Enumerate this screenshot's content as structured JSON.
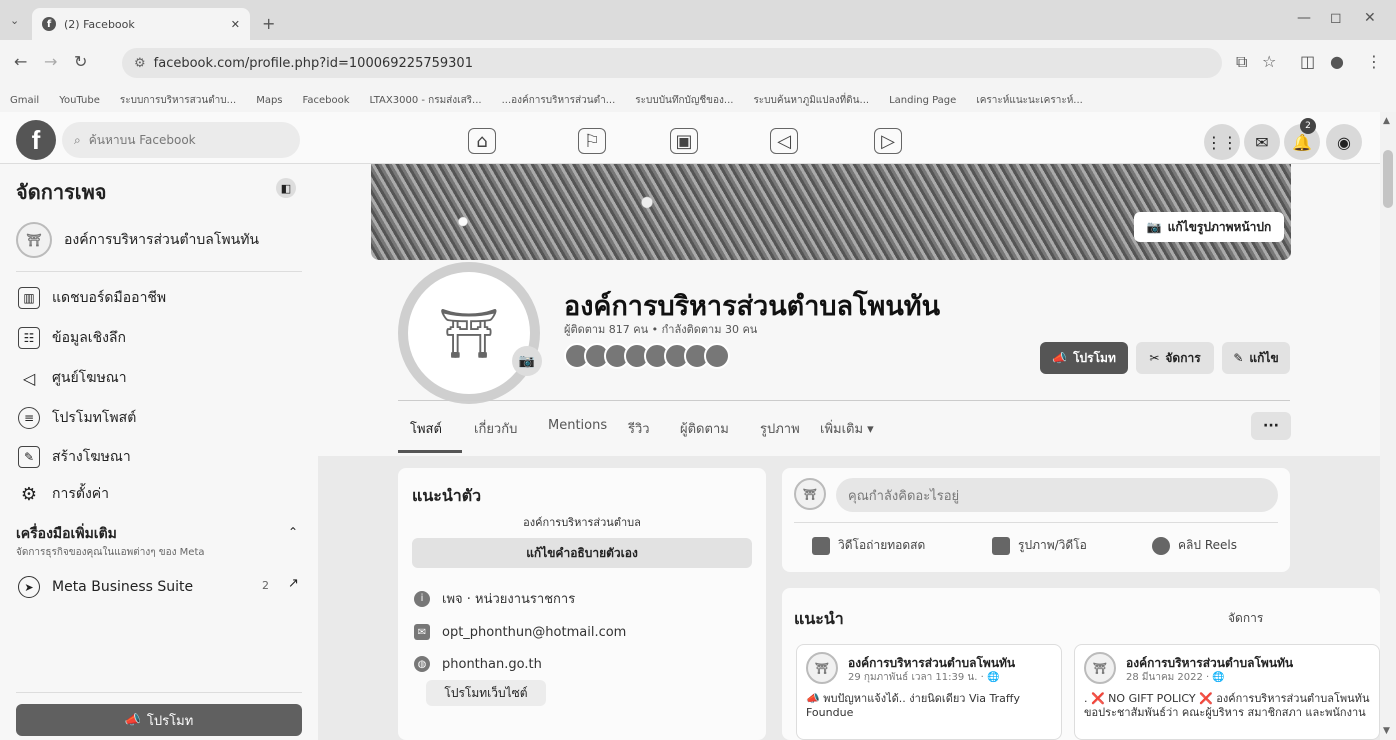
{
  "browser": {
    "tab_title": "(2) Facebook",
    "url": "facebook.com/profile.php?id=100069225759301",
    "bookmarks": [
      "Gmail",
      "YouTube",
      "ระบบการบริหารสวนตำบ...",
      "Maps",
      "Facebook",
      "LTAX3000 - กรมส่งเสริ...",
      "...องค์การบริหารส่วนตำ...",
      "ระบบบันทึกบัญชีของ...",
      "ระบบค้นหาภูมิแปลงที่ดิน...",
      "Landing Page",
      "เคราะห์แนะนะเคราะห์..."
    ]
  },
  "fb_header": {
    "logo": "f",
    "search_placeholder": "ค้นหาบน Facebook",
    "notification_count": "2"
  },
  "sidebar": {
    "title": "จัดการเพจ",
    "page_name": "องค์การบริหารส่วนตำบลโพนทัน",
    "items": [
      {
        "label": "แดชบอร์ดมืออาชีพ",
        "icon": "chart-icon"
      },
      {
        "label": "ข้อมูลเชิงลึก",
        "icon": "insights-icon"
      },
      {
        "label": "ศูนย์โฆษณา",
        "icon": "megaphone-icon"
      },
      {
        "label": "โปรโมทโพสต์",
        "icon": "promote-post-icon"
      },
      {
        "label": "สร้างโฆษณา",
        "icon": "edit-icon"
      },
      {
        "label": "การตั้งค่า",
        "icon": "gear-icon"
      }
    ],
    "tools_title": "เครื่องมือเพิ่มเติม",
    "tools_subtitle": "จัดการธุรกิจของคุณในแอพต่างๆ ของ Meta",
    "mbs_label": "Meta Business Suite",
    "mbs_count": "2",
    "promote_label": "โปรโมท"
  },
  "profile": {
    "cover_edit_label": "แก้ไขรูปภาพหน้าปก",
    "name": "องค์การบริหารส่วนตำบลโพนทัน",
    "followers_line": "ผู้ติดตาม 817 คน • กำลังติดตาม 30 คน",
    "promote_btn": "โปรโมท",
    "manage_btn": "จัดการ",
    "edit_btn": "แก้ไข",
    "tabs": [
      "โพสต์",
      "เกี่ยวกับ",
      "Mentions",
      "รีวิว",
      "ผู้ติดตาม",
      "รูปภาพ",
      "เพิ่มเติม ▾"
    ],
    "more_btn": "···"
  },
  "intro": {
    "title": "แนะนำตัว",
    "bio": "องค์การบริหารส่วนตำบล",
    "edit_bio": "แก้ไขคำอธิบายตัวเอง",
    "category": "เพจ · หน่วยงานราชการ",
    "email": "opt_phonthun@hotmail.com",
    "website": "phonthan.go.th",
    "promote_web": "โปรโมทเว็บไซต์"
  },
  "composer": {
    "placeholder": "คุณกำลังคิดอะไรอยู่",
    "live": "วิดีโอถ่ายทอดสด",
    "photo": "รูปภาพ/วิดีโอ",
    "reel": "คลิป Reels"
  },
  "recommend": {
    "title": "แนะนำ",
    "manage": "จัดการ",
    "posts": [
      {
        "name": "องค์การบริหารส่วนตำบลโพนทัน",
        "date": "29 กุมภาพันธ์ เวลา 11:39 น. · 🌐",
        "body": "📣 พบปัญหาแจ้งได้.. ง่ายนิดเดียว Via Traffy Foundue"
      },
      {
        "name": "องค์การบริหารส่วนตำบลโพนทัน",
        "date": "28 มีนาคม 2022 · 🌐",
        "body": ". ❌ NO GIFT POLICY ❌ องค์การบริหารส่วนตำบลโพนทัน ขอประชาสัมพันธ์ว่า คณะผู้บริหาร สมาชิกสภา และพนักงาน"
      }
    ]
  }
}
